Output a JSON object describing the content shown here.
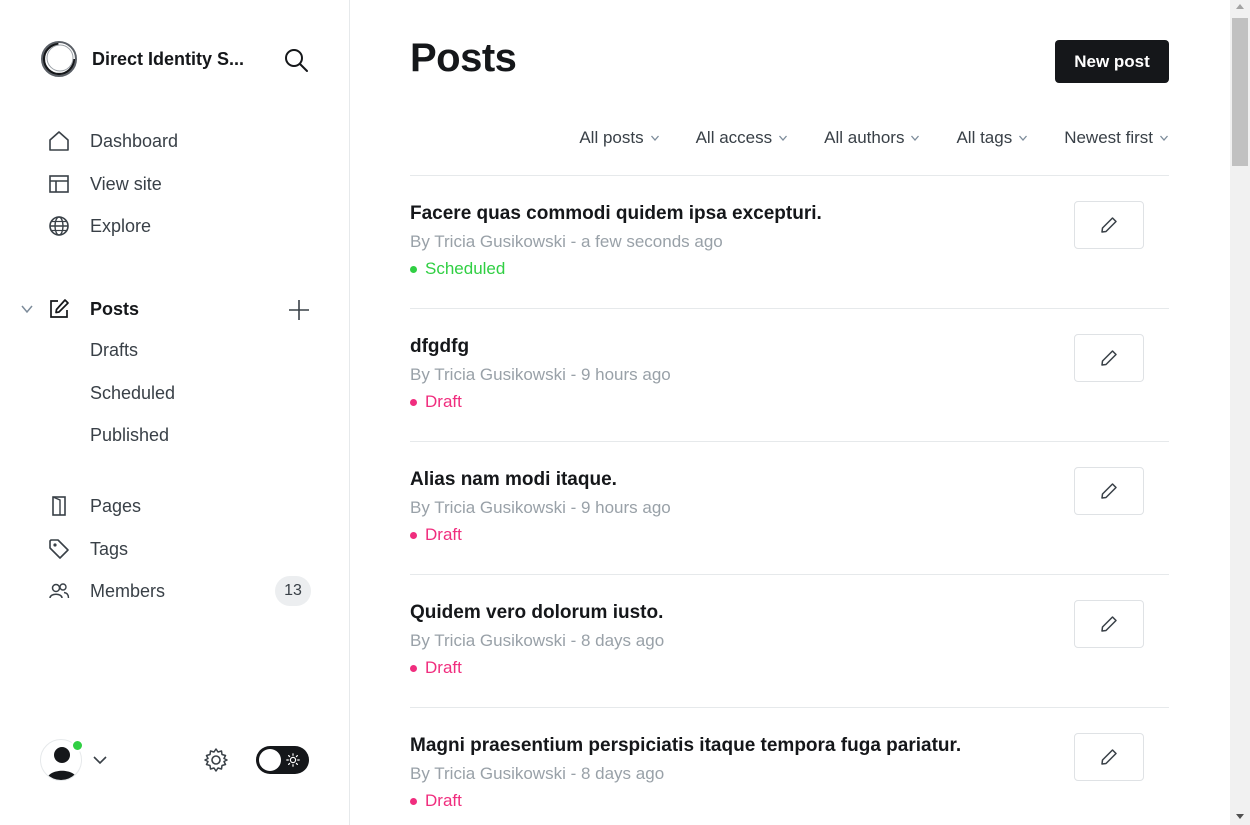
{
  "sidebar": {
    "brand_name": "Direct Identity S...",
    "nav": [
      {
        "label": "Dashboard",
        "icon": "home-icon"
      },
      {
        "label": "View site",
        "icon": "layout-icon"
      },
      {
        "label": "Explore",
        "icon": "globe-icon"
      }
    ],
    "posts": {
      "label": "Posts",
      "icon": "pencil-square-icon",
      "sub_items": [
        "Drafts",
        "Scheduled",
        "Published"
      ]
    },
    "secondary": [
      {
        "label": "Pages",
        "icon": "page-icon"
      },
      {
        "label": "Tags",
        "icon": "tag-icon"
      },
      {
        "label": "Members",
        "icon": "members-icon"
      }
    ],
    "members_count": "13"
  },
  "header": {
    "title": "Posts",
    "new_post_label": "New post"
  },
  "filters": [
    "All posts",
    "All access",
    "All authors",
    "All tags",
    "Newest first"
  ],
  "posts": [
    {
      "title": "Facere quas commodi quidem ipsa excepturi.",
      "meta": "By Tricia Gusikowski - a few seconds ago",
      "status": "Scheduled"
    },
    {
      "title": "dfgdfg",
      "meta": "By Tricia Gusikowski - 9 hours ago",
      "status": "Draft"
    },
    {
      "title": "Alias nam modi itaque.",
      "meta": "By Tricia Gusikowski - 9 hours ago",
      "status": "Draft"
    },
    {
      "title": "Quidem vero dolorum iusto.",
      "meta": "By Tricia Gusikowski - 8 days ago",
      "status": "Draft"
    },
    {
      "title": "Magni praesentium perspiciatis itaque tempora fuga pariatur.",
      "meta": "By Tricia Gusikowski - 8 days ago",
      "status": "Draft"
    }
  ],
  "colors": {
    "scheduled": "#30cf43",
    "draft": "#f02d7e",
    "primary_button": "#15171a",
    "online": "#30cf43"
  }
}
